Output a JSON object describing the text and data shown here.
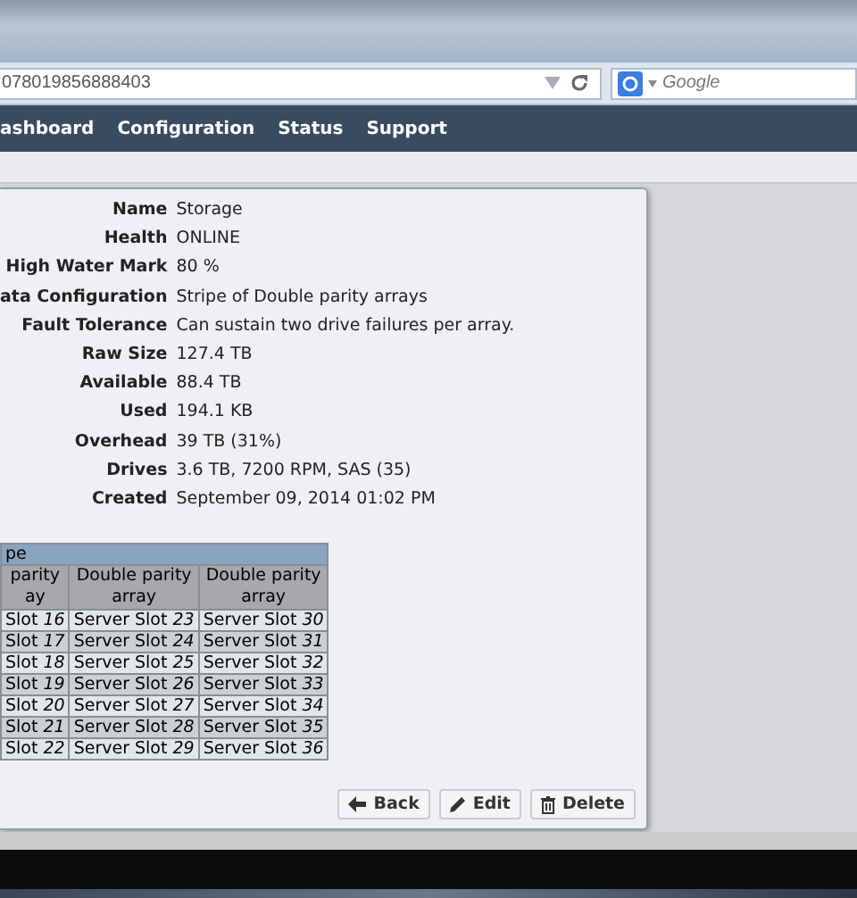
{
  "browser": {
    "url": "078019856888403",
    "search_placeholder": "Google"
  },
  "nav": [
    {
      "label": "ashboard"
    },
    {
      "label": "Configuration"
    },
    {
      "label": "Status"
    },
    {
      "label": "Support"
    }
  ],
  "details": [
    {
      "label": "Name",
      "value": "Storage"
    },
    {
      "label": "Health",
      "value": "ONLINE"
    },
    {
      "label": "High Water Mark",
      "value": "80 %"
    },
    {
      "label": "ata Configuration",
      "value": "Stripe of Double parity arrays"
    },
    {
      "label": "Fault Tolerance",
      "value": "Can sustain two drive failures per array."
    },
    {
      "label": "Raw Size",
      "value": "127.4 TB"
    },
    {
      "label": "Available",
      "value": "88.4 TB"
    },
    {
      "label": "Used",
      "value": "194.1 KB"
    },
    {
      "label": "Overhead",
      "value": "39 TB (31%)"
    },
    {
      "label": "Drives",
      "value": "3.6 TB, 7200 RPM, SAS (35)"
    },
    {
      "label": "Created",
      "value": "September 09, 2014 01:02 PM"
    }
  ],
  "layout_table": {
    "title": "pe",
    "columns": [
      "parity ay",
      "Double parity array",
      "Double parity array"
    ],
    "rows": [
      [
        "Slot *16*",
        "Server Slot *23*",
        "Server Slot *30*"
      ],
      [
        "Slot *17*",
        "Server Slot *24*",
        "Server Slot *31*"
      ],
      [
        "Slot *18*",
        "Server Slot *25*",
        "Server Slot *32*"
      ],
      [
        "Slot *19*",
        "Server Slot *26*",
        "Server Slot *33*"
      ],
      [
        "Slot *20*",
        "Server Slot *27*",
        "Server Slot *34*"
      ],
      [
        "Slot *21*",
        "Server Slot *28*",
        "Server Slot *35*"
      ],
      [
        "Slot *22*",
        "Server Slot *29*",
        "Server Slot *36*"
      ]
    ]
  },
  "buttons": [
    {
      "label": "Back",
      "kind": "back"
    },
    {
      "label": "Edit",
      "kind": "edit"
    },
    {
      "label": "Delete",
      "kind": "delete"
    }
  ]
}
